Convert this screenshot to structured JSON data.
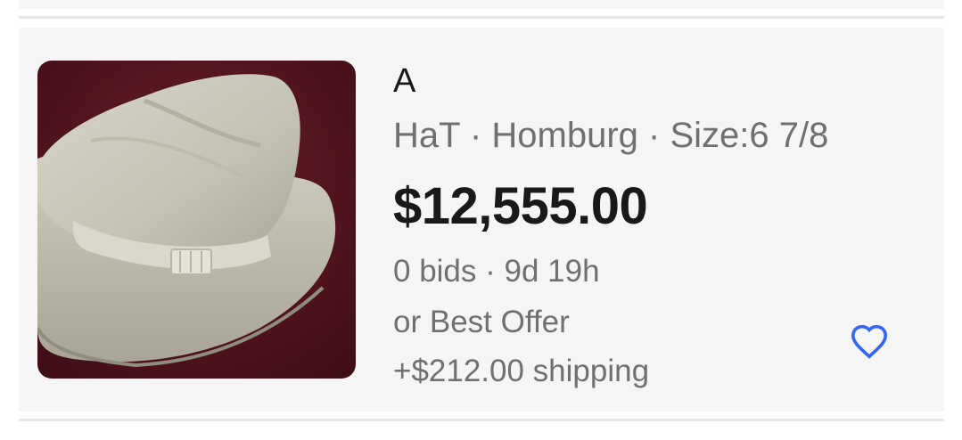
{
  "listing": {
    "title": "A",
    "subtitle": "HaT · Homburg · Size:6 7/8",
    "price": "$12,555.00",
    "bids_time": "0 bids · 9d 19h",
    "best_offer": "or Best Offer",
    "shipping": "+$212.00 shipping",
    "image_icon": "hat-photo",
    "watch_icon": "heart-icon",
    "accent_color": "#3665f3"
  }
}
